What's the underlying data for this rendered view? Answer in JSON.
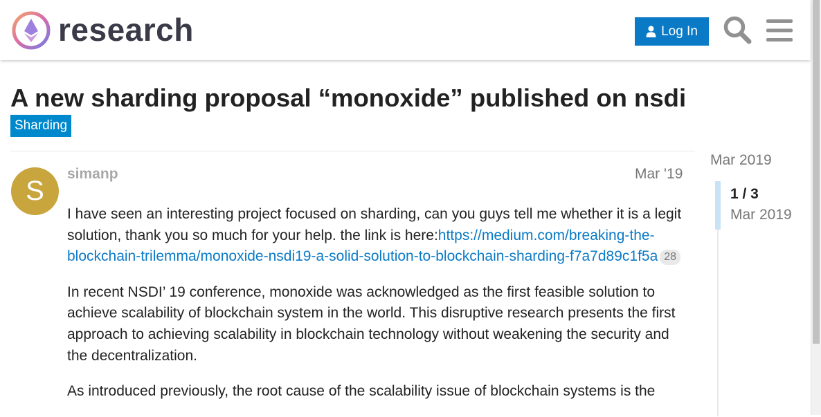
{
  "header": {
    "brand": "research",
    "login_label": "Log In",
    "colors": {
      "login_bg": "#0a7ac6",
      "category_bg": "#0088cc",
      "link": "#0a7ac6"
    }
  },
  "topic": {
    "title": "A new sharding proposal “monoxide” published on nsdi",
    "category": "Sharding"
  },
  "post": {
    "avatar_letter": "S",
    "username": "simanp",
    "date": "Mar '19",
    "p1_text": "I have seen an interesting project focused on sharding, can you guys tell me whether it is a legit solution, thank you so much for your help. the link is here:",
    "p1_link": "https://medium.com/breaking-the-blockchain-trilemma/monoxide-nsdi19-a-solid-solution-to-blockchain-sharding-f7a7d89c1f5a",
    "p1_clicks": "28",
    "p2": "In recent NSDI’ 19 conference, monoxide was acknowledged as the first feasible solution to achieve scalability of blockchain system in the world. This disruptive research presents the first approach to achieving scalability in blockchain technology without weakening the security and the decentralization.",
    "p3": "As introduced previously, the root cause of the scalability issue of blockchain systems is the"
  },
  "timeline": {
    "start_date": "Mar 2019",
    "position": "1 / 3",
    "current_date": "Mar 2019"
  },
  "icons": [
    "logo-icon",
    "user-icon",
    "search-icon",
    "hamburger-menu-icon"
  ]
}
